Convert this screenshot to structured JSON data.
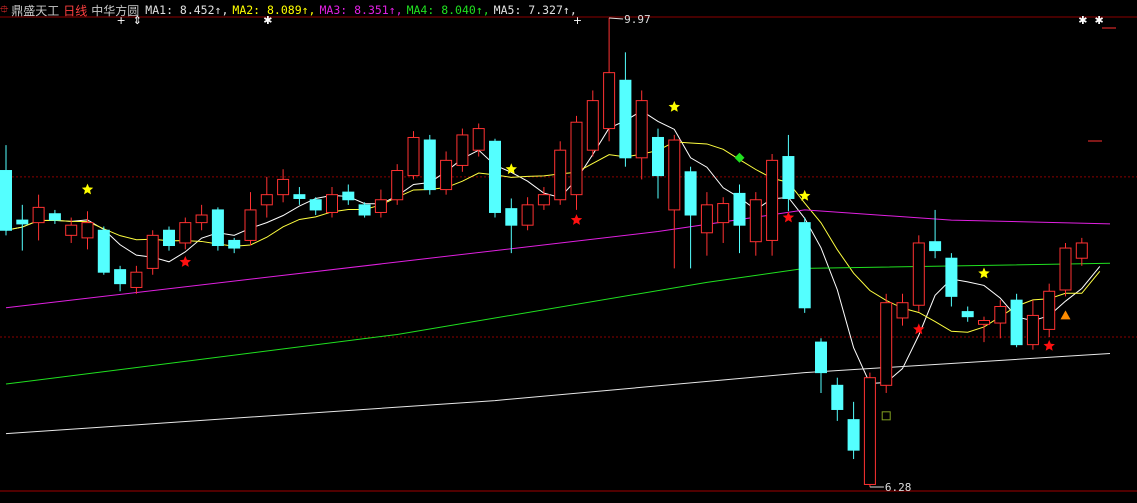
{
  "header": {
    "stock_name": "鼎盛天工",
    "period": "日线",
    "indicator_name": "中华方圆",
    "ma": [
      {
        "label": "MA1: 8.452↑,",
        "color": "#e0e0e0"
      },
      {
        "label": "MA2: 8.089↑,",
        "color": "#ffff00"
      },
      {
        "label": "MA3: 8.351↑,",
        "color": "#ff00ff"
      },
      {
        "label": "MA4: 8.040↑,",
        "color": "#00e000"
      },
      {
        "label": "MA5: 7.327↑,",
        "color": "#c8c8c8"
      }
    ]
  },
  "colors": {
    "up": "#ff3232",
    "down": "#54ffff",
    "grid": "#8b0000",
    "bg": "#000000"
  },
  "chart_data": {
    "type": "candlestick",
    "ylim": [
      6.26,
      10.0
    ],
    "high_label": "9.97",
    "low_label": "6.28",
    "gridlines": [
      8.72,
      7.46
    ],
    "candles": [
      {
        "o": 8.77,
        "c": 8.3,
        "h": 8.97,
        "l": 8.26
      },
      {
        "o": 8.38,
        "c": 8.35,
        "h": 8.5,
        "l": 8.14
      },
      {
        "o": 8.36,
        "c": 8.48,
        "h": 8.58,
        "l": 8.22
      },
      {
        "o": 8.43,
        "c": 8.38,
        "h": 8.46,
        "l": 8.35
      },
      {
        "o": 8.26,
        "c": 8.34,
        "h": 8.4,
        "l": 8.2
      },
      {
        "o": 8.24,
        "c": 8.36,
        "h": 8.45,
        "l": 8.15
      },
      {
        "o": 8.3,
        "c": 7.97,
        "h": 8.33,
        "l": 7.95
      },
      {
        "o": 7.99,
        "c": 7.88,
        "h": 8.02,
        "l": 7.82
      },
      {
        "o": 7.85,
        "c": 7.97,
        "h": 8.02,
        "l": 7.8
      },
      {
        "o": 8.0,
        "c": 8.26,
        "h": 8.3,
        "l": 7.95
      },
      {
        "o": 8.3,
        "c": 8.18,
        "h": 8.33,
        "l": 8.14
      },
      {
        "o": 8.2,
        "c": 8.36,
        "h": 8.4,
        "l": 8.15
      },
      {
        "o": 8.36,
        "c": 8.42,
        "h": 8.5,
        "l": 8.3
      },
      {
        "o": 8.46,
        "c": 8.18,
        "h": 8.48,
        "l": 8.14
      },
      {
        "o": 8.22,
        "c": 8.16,
        "h": 8.24,
        "l": 8.12
      },
      {
        "o": 8.22,
        "c": 8.46,
        "h": 8.6,
        "l": 8.18
      },
      {
        "o": 8.5,
        "c": 8.58,
        "h": 8.72,
        "l": 8.4
      },
      {
        "o": 8.58,
        "c": 8.7,
        "h": 8.78,
        "l": 8.52
      },
      {
        "o": 8.58,
        "c": 8.55,
        "h": 8.64,
        "l": 8.5
      },
      {
        "o": 8.54,
        "c": 8.46,
        "h": 8.56,
        "l": 8.42
      },
      {
        "o": 8.44,
        "c": 8.58,
        "h": 8.64,
        "l": 8.4
      },
      {
        "o": 8.6,
        "c": 8.54,
        "h": 8.66,
        "l": 8.5
      },
      {
        "o": 8.5,
        "c": 8.42,
        "h": 8.52,
        "l": 8.4
      },
      {
        "o": 8.44,
        "c": 8.54,
        "h": 8.62,
        "l": 8.4
      },
      {
        "o": 8.54,
        "c": 8.77,
        "h": 8.82,
        "l": 8.5
      },
      {
        "o": 8.73,
        "c": 9.03,
        "h": 9.08,
        "l": 8.7
      },
      {
        "o": 9.01,
        "c": 8.62,
        "h": 9.05,
        "l": 8.58
      },
      {
        "o": 8.62,
        "c": 8.85,
        "h": 8.92,
        "l": 8.58
      },
      {
        "o": 8.81,
        "c": 9.05,
        "h": 9.1,
        "l": 8.76
      },
      {
        "o": 8.93,
        "c": 9.1,
        "h": 9.14,
        "l": 8.88
      },
      {
        "o": 9.0,
        "c": 8.44,
        "h": 9.02,
        "l": 8.4
      },
      {
        "o": 8.47,
        "c": 8.34,
        "h": 8.55,
        "l": 8.12
      },
      {
        "o": 8.34,
        "c": 8.5,
        "h": 8.56,
        "l": 8.3
      },
      {
        "o": 8.5,
        "c": 8.58,
        "h": 8.64,
        "l": 8.46
      },
      {
        "o": 8.54,
        "c": 8.93,
        "h": 9.0,
        "l": 8.5
      },
      {
        "o": 8.58,
        "c": 9.15,
        "h": 9.2,
        "l": 8.46
      },
      {
        "o": 8.93,
        "c": 9.32,
        "h": 9.4,
        "l": 8.88
      },
      {
        "o": 9.1,
        "c": 9.54,
        "h": 9.97,
        "l": 9.0
      },
      {
        "o": 9.48,
        "c": 8.87,
        "h": 9.7,
        "l": 8.8
      },
      {
        "o": 8.87,
        "c": 9.32,
        "h": 9.4,
        "l": 8.7
      },
      {
        "o": 9.03,
        "c": 8.73,
        "h": 9.1,
        "l": 8.55
      },
      {
        "o": 8.46,
        "c": 9.01,
        "h": 9.05,
        "l": 8.0
      },
      {
        "o": 8.76,
        "c": 8.42,
        "h": 8.8,
        "l": 8.0
      },
      {
        "o": 8.28,
        "c": 8.5,
        "h": 8.6,
        "l": 8.1
      },
      {
        "o": 8.36,
        "c": 8.51,
        "h": 8.56,
        "l": 8.2
      },
      {
        "o": 8.59,
        "c": 8.34,
        "h": 8.66,
        "l": 8.12
      },
      {
        "o": 8.21,
        "c": 8.54,
        "h": 8.6,
        "l": 8.1
      },
      {
        "o": 8.22,
        "c": 8.85,
        "h": 8.9,
        "l": 8.1
      },
      {
        "o": 8.88,
        "c": 8.55,
        "h": 9.05,
        "l": 8.45
      },
      {
        "o": 8.36,
        "c": 7.69,
        "h": 8.4,
        "l": 7.65
      },
      {
        "o": 7.42,
        "c": 7.18,
        "h": 7.45,
        "l": 7.02
      },
      {
        "o": 7.08,
        "c": 6.89,
        "h": 7.14,
        "l": 6.8
      },
      {
        "o": 6.81,
        "c": 6.57,
        "h": 6.95,
        "l": 6.5
      },
      {
        "o": 6.3,
        "c": 7.14,
        "h": 7.18,
        "l": 6.28
      },
      {
        "o": 7.08,
        "c": 7.73,
        "h": 7.8,
        "l": 7.02
      },
      {
        "o": 7.61,
        "c": 7.73,
        "h": 7.8,
        "l": 7.55
      },
      {
        "o": 7.71,
        "c": 8.2,
        "h": 8.26,
        "l": 7.66
      },
      {
        "o": 8.21,
        "c": 8.14,
        "h": 8.46,
        "l": 8.08
      },
      {
        "o": 8.08,
        "c": 7.78,
        "h": 8.12,
        "l": 7.7
      },
      {
        "o": 7.66,
        "c": 7.62,
        "h": 7.7,
        "l": 7.58
      },
      {
        "o": 7.56,
        "c": 7.59,
        "h": 7.62,
        "l": 7.42
      },
      {
        "o": 7.57,
        "c": 7.7,
        "h": 7.75,
        "l": 7.45
      },
      {
        "o": 7.75,
        "c": 7.4,
        "h": 7.8,
        "l": 7.38
      },
      {
        "o": 7.4,
        "c": 7.63,
        "h": 7.75,
        "l": 7.36
      },
      {
        "o": 7.52,
        "c": 7.82,
        "h": 7.88,
        "l": 7.46
      },
      {
        "o": 7.83,
        "c": 8.16,
        "h": 8.2,
        "l": 7.78
      },
      {
        "o": 8.08,
        "c": 8.2,
        "h": 8.24,
        "l": 8.02
      }
    ],
    "ma_lines": [
      {
        "name": "MA1",
        "color": "#ffffff",
        "period": 5
      },
      {
        "name": "MA2",
        "color": "#ffff40",
        "period": 10
      },
      {
        "name": "MA3",
        "color": "#e020e0",
        "points": [
          [
            0,
            7.69
          ],
          [
            24,
            8.05
          ],
          [
            40,
            8.29
          ],
          [
            49,
            8.46
          ],
          [
            58,
            8.38
          ],
          [
            66,
            8.35
          ]
        ]
      },
      {
        "name": "MA4",
        "color": "#20e020",
        "points": [
          [
            0,
            7.09
          ],
          [
            24,
            7.48
          ],
          [
            43,
            7.89
          ],
          [
            49,
            8.0
          ],
          [
            66,
            8.04
          ]
        ]
      },
      {
        "name": "MA5",
        "color": "#e8e8e8",
        "points": [
          [
            0,
            6.7
          ],
          [
            30,
            6.96
          ],
          [
            49,
            7.18
          ],
          [
            66,
            7.33
          ]
        ]
      }
    ],
    "signals": [
      {
        "type": "yellow-star",
        "i": 5,
        "p": 8.62
      },
      {
        "type": "yellow-star",
        "i": 31,
        "p": 8.78
      },
      {
        "type": "yellow-star",
        "i": 41,
        "p": 9.27
      },
      {
        "type": "yellow-star",
        "i": 49,
        "p": 8.57
      },
      {
        "type": "yellow-star",
        "i": 60,
        "p": 7.96
      },
      {
        "type": "red-star",
        "i": 11,
        "p": 8.05
      },
      {
        "type": "red-star",
        "i": 35,
        "p": 8.38
      },
      {
        "type": "red-star",
        "i": 48,
        "p": 8.4
      },
      {
        "type": "red-star",
        "i": 56,
        "p": 7.52
      },
      {
        "type": "red-star",
        "i": 64,
        "p": 7.39
      },
      {
        "type": "green-diamond",
        "i": 45,
        "p": 8.87
      },
      {
        "type": "orange-triangle",
        "i": 65,
        "p": 7.63
      },
      {
        "type": "olive-square",
        "i": 54,
        "p": 6.84
      }
    ],
    "top_marks": [
      {
        "type": "plus",
        "i": 7
      },
      {
        "type": "double-arrow",
        "i": 8
      },
      {
        "type": "asterisk",
        "i": 16
      },
      {
        "type": "plus",
        "i": 35
      },
      {
        "type": "asterisk",
        "i": 66
      },
      {
        "type": "asterisk",
        "i": 67
      }
    ]
  }
}
